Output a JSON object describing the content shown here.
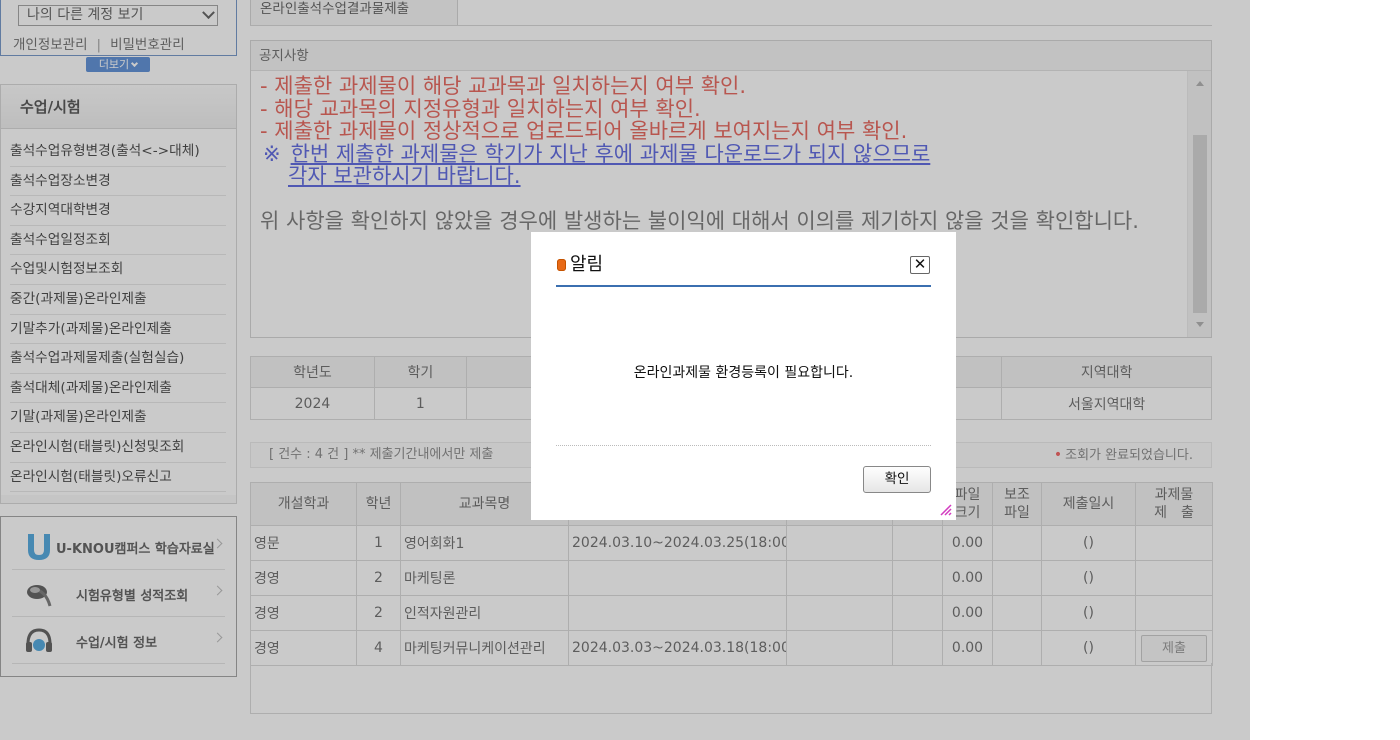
{
  "sidebar": {
    "account_select": "나의 다른 계정 보기",
    "links": [
      "개인정보관리",
      "비밀번호관리"
    ],
    "link_separator": "|",
    "more_label": "더보기",
    "menu_title": "수업/시험",
    "menu_items": [
      "출석수업유형변경(출석<->대체)",
      "출석수업장소변경",
      "수강지역대학변경",
      "출석수업일정조회",
      "수업및시험정보조회",
      "중간(과제물)온라인제출",
      "기말추가(과제물)온라인제출",
      "출석수업과제물제출(실험실습)",
      "출석대체(과제물)온라인제출",
      "기말(과제물)온라인제출",
      "온라인시험(태블릿)신청및조회",
      "온라인시험(태블릿)오류신고"
    ],
    "quick_links": [
      {
        "label": "U-KNOU캠퍼스 학습자료실",
        "icon": "u-knou-logo-icon"
      },
      {
        "label": "시험유형별 성적조회",
        "icon": "pen-icon"
      },
      {
        "label": "수업/시험 정보",
        "icon": "headset-icon"
      }
    ]
  },
  "main": {
    "tab_title": "온라인출석수업결과물제출",
    "notice": {
      "heading": "공지사항",
      "red_lines": [
        "- 제출한 과제물이 해당 교과목과 일치하는지 여부 확인.",
        "- 해당 교과목의 지정유형과 일치하는지 여부 확인.",
        "- 제출한 과제물이 정상적으로 업로드되어 올바르게 보여지는지 여부 확인."
      ],
      "link_mark": "※",
      "link_line1": "한번 제출한 과제물은 학기가 지난 후에 과제물 다운로드가 되지 않으므로",
      "link_line2": "각자 보관하시기 바랍니다.",
      "plain_text": "위 사항을 확인하지 않았을 경우에 발생하는 불이익에 대해서 이의를 제기하지 않을 것을 확인합니다."
    },
    "info_table": {
      "headers": [
        "학년도",
        "학기",
        "",
        "지역대학"
      ],
      "values": [
        "2024",
        "1",
        "",
        "서울지역대학"
      ]
    },
    "status_left": "[ 건수 : 4 건 ] ** 제출기간내에서만 제출",
    "status_right": "조회가 완료되었습니다.",
    "status_dot": "•",
    "list_table": {
      "headers": [
        "개설학과",
        "학년",
        "교과목명",
        "",
        "",
        "",
        "파일\n크기",
        "보조\n파일",
        "제출일시",
        "과제물\n제　출"
      ],
      "rows": [
        [
          "영문",
          "1",
          "영어회화1",
          "2024.03.10~2024.03.25(18:00",
          "",
          "",
          "0.00",
          "",
          "()",
          ""
        ],
        [
          "경영",
          "2",
          "마케팅론",
          "",
          "",
          "",
          "0.00",
          "",
          "()",
          ""
        ],
        [
          "경영",
          "2",
          "인적자원관리",
          "",
          "",
          "",
          "0.00",
          "",
          "()",
          ""
        ],
        [
          "경영",
          "4",
          "마케팅커뮤니케이션관리",
          "2024.03.03~2024.03.18(18:00",
          "",
          "",
          "0.00",
          "",
          "()",
          "제출"
        ]
      ]
    }
  },
  "modal": {
    "title": "알림",
    "close_label": "✕",
    "message": "온라인과제물 환경등록이 필요합니다.",
    "ok_label": "확인"
  },
  "colors": {
    "notice_red": "#e0382c",
    "notice_link_blue": "#2d3bd8",
    "accent_blue": "#3b6fb0",
    "more_button_blue": "#2d6fcc"
  }
}
